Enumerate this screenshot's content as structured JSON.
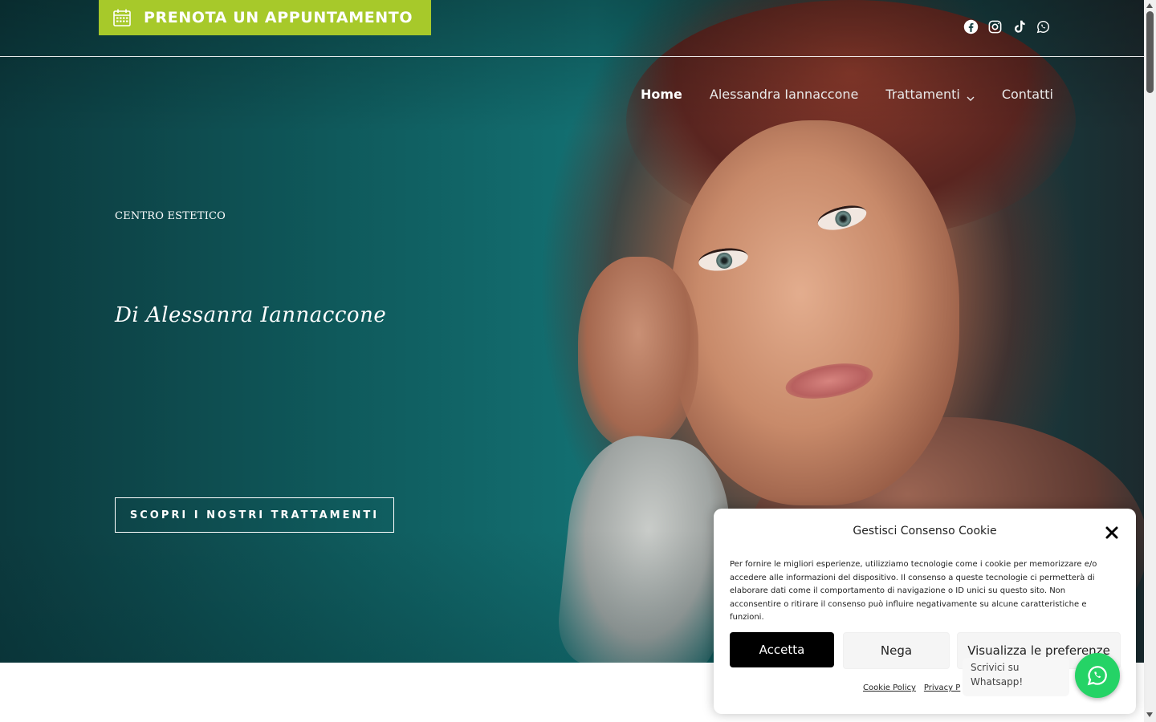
{
  "topbar": {
    "book_button_label": "PRENOTA UN APPUNTAMENTO",
    "book_button_color": "#a7c92a",
    "social_icons": [
      "facebook-icon",
      "instagram-icon",
      "tiktok-icon",
      "whatsapp-icon"
    ]
  },
  "nav": {
    "items": [
      {
        "label": "Home",
        "active": true
      },
      {
        "label": "Alessandra Iannaccone",
        "active": false
      },
      {
        "label": "Trattamenti",
        "active": false,
        "has_dropdown": true
      },
      {
        "label": "Contatti",
        "active": false
      }
    ]
  },
  "hero": {
    "eyebrow": "CENTRO ESTETICO",
    "script_title": "Di Alessanra Iannaccone",
    "cta_label": "SCOPRI I NOSTRI TRATTAMENTI"
  },
  "cookie_banner": {
    "title": "Gestisci Consenso Cookie",
    "text": "Per fornire le migliori esperienze, utilizziamo tecnologie come i cookie per memorizzare e/o accedere alle informazioni del dispositivo. Il consenso a queste tecnologie ci permetterà di elaborare dati come il comportamento di navigazione o ID unici su questo sito. Non acconsentire o ritirare il consenso può influire negativamente su alcune caratteristiche e funzioni.",
    "accept_label": "Accetta",
    "deny_label": "Nega",
    "prefs_label": "Visualizza le preferenze",
    "links": [
      "Cookie Policy",
      "Privacy P"
    ]
  },
  "whatsapp": {
    "tooltip": "Scrivici su Whatsapp!",
    "color": "#25d366"
  }
}
